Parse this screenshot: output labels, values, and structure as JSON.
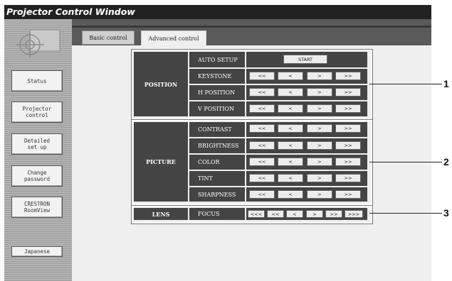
{
  "window": {
    "title": "Projector Control Window"
  },
  "sidebar": {
    "items": [
      {
        "id": "status",
        "label": "Status"
      },
      {
        "id": "projector-control",
        "label": "Projector\ncontrol"
      },
      {
        "id": "detailed-setup",
        "label": "Detailed\nset up"
      },
      {
        "id": "change-password",
        "label": "Change\npassword"
      },
      {
        "id": "crestron",
        "label": "CRESTRON\nRoomView"
      }
    ],
    "language_button": "Japanese"
  },
  "tabs": [
    {
      "label": "Basic control",
      "active": false
    },
    {
      "label": "Advanced control",
      "active": true
    }
  ],
  "groups": [
    {
      "name": "POSITION",
      "callout": "1",
      "rows": [
        {
          "label": "AUTO SETUP",
          "buttons": [
            "START"
          ]
        },
        {
          "label": "KEYSTONE",
          "buttons": [
            "<<",
            "<",
            ">",
            ">>"
          ]
        },
        {
          "label": "H POSITION",
          "buttons": [
            "<<",
            "<",
            ">",
            ">>"
          ]
        },
        {
          "label": "V POSITION",
          "buttons": [
            "<<",
            "<",
            ">",
            ">>"
          ]
        }
      ]
    },
    {
      "name": "PICTURE",
      "callout": "2",
      "rows": [
        {
          "label": "CONTRAST",
          "buttons": [
            "<<",
            "<",
            ">",
            ">>"
          ]
        },
        {
          "label": "BRIGHTNESS",
          "buttons": [
            "<<",
            "<",
            ">",
            ">>"
          ]
        },
        {
          "label": "COLOR",
          "buttons": [
            "<<",
            "<",
            ">",
            ">>"
          ]
        },
        {
          "label": "TINT",
          "buttons": [
            "<<",
            "<",
            ">",
            ">>"
          ]
        },
        {
          "label": "SHARPNESS",
          "buttons": [
            "<<",
            "<",
            ">",
            ">>"
          ]
        }
      ]
    },
    {
      "name": "LENS",
      "callout": "3",
      "rows": [
        {
          "label": "FOCUS",
          "buttons": [
            "<<<",
            "<<",
            "<",
            ">",
            ">>",
            ">>>"
          ]
        }
      ]
    }
  ],
  "colors": {
    "titlebar": "#222222",
    "panel": "#5a5a5a",
    "row_bg": "#444444",
    "button": "#ececec"
  }
}
